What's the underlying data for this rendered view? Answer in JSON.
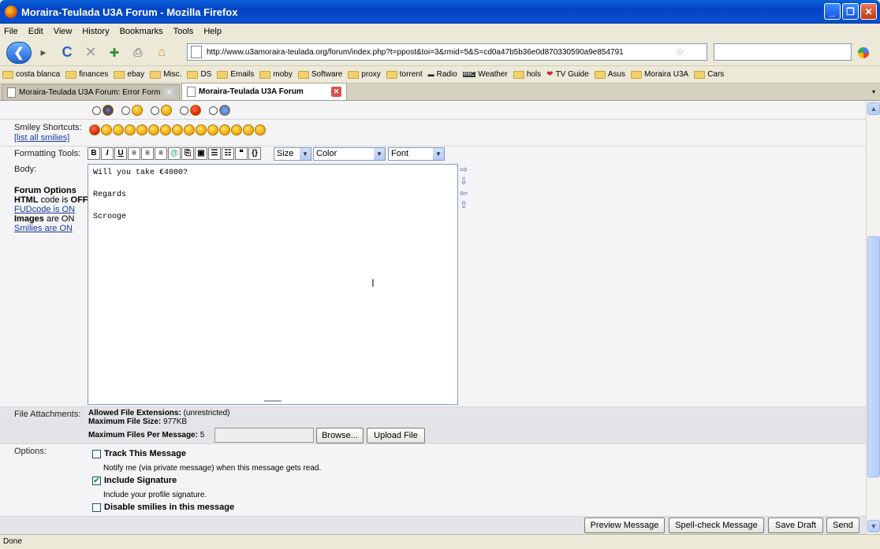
{
  "window": {
    "title": "Moraira-Teulada U3A Forum - Mozilla Firefox"
  },
  "menu": [
    "File",
    "Edit",
    "View",
    "History",
    "Bookmarks",
    "Tools",
    "Help"
  ],
  "nav": {
    "url": "http://www.u3amoraira-teulada.org/forum/index.php?t=ppost&toi=3&rmid=5&S=cd0a47b5b36e0d870330590a9e854791"
  },
  "bookmarks": [
    "costa blanca",
    "finances",
    "ebay",
    "Misc.",
    "DS",
    "Emails",
    "moby",
    "Software",
    "proxy",
    "torrent",
    "Radio",
    "Weather",
    "hols",
    "TV Guide",
    "Asus",
    "Moraira U3A",
    "Cars"
  ],
  "tabs": [
    {
      "label": "Moraira-Teulada U3A Forum: Error Form"
    },
    {
      "label": "Moraira-Teulada U3A Forum"
    }
  ],
  "form": {
    "smiley_label": "Smiley Shortcuts:",
    "list_smilies": "[list all smilies]",
    "formatting_label": "Formatting Tools:",
    "size_select": "Size",
    "color_select": "Color",
    "font_select": "Font",
    "body_label": "Body:",
    "body_text": "Will you take €4000?\n\nRegards\n\nScrooge",
    "forum_options": {
      "title": "Forum Options",
      "html_prefix": "HTML",
      "html_mid": " code is ",
      "html_state": "OFF",
      "fud_link": "FUDcode is ON",
      "images_prefix": "Images",
      "images_state": " are ON",
      "smilies_link": "Smilies are ON"
    },
    "attachments_label": "File Attachments:",
    "allowed_ext_label": "Allowed File Extensions:",
    "allowed_ext_value": " (unrestricted)",
    "max_size_label": "Maximum File Size:",
    "max_size_value": " 977KB",
    "max_files_label": "Maximum Files Per Message:",
    "max_files_value": " 5",
    "browse_button": "Browse...",
    "upload_button": "Upload File",
    "options_label": "Options:",
    "track_label": "Track This Message",
    "track_desc": "Notify me (via private message) when this message gets read.",
    "signature_label": "Include Signature",
    "signature_desc": "Include your profile signature.",
    "disable_smilies_label": "Disable smilies in this message",
    "preview_button": "Preview Message",
    "spellcheck_button": "Spell-check Message",
    "savedraft_button": "Save Draft",
    "send_button": "Send"
  },
  "status": "Done"
}
